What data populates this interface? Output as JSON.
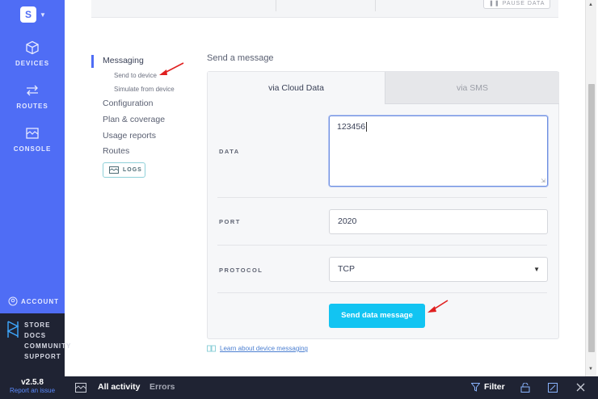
{
  "rail": {
    "logo_letter": "S",
    "items": [
      {
        "label": "DEVICES",
        "icon": "cube-icon"
      },
      {
        "label": "ROUTES",
        "icon": "routes-icon"
      },
      {
        "label": "CONSOLE",
        "icon": "console-icon"
      }
    ],
    "account_label": "ACCOUNT",
    "links": [
      "STORE",
      "DOCS",
      "COMMUNITY",
      "SUPPORT"
    ],
    "version": "v2.5.8",
    "report_issue": "Report an issue"
  },
  "topbar": {
    "pause_label": "PAUSE DATA"
  },
  "nav": {
    "messaging": "Messaging",
    "send_to_device": "Send to device",
    "simulate_from_device": "Simulate from device",
    "configuration": "Configuration",
    "plan_coverage": "Plan & coverage",
    "usage_reports": "Usage reports",
    "routes": "Routes",
    "logs": "LOGS"
  },
  "main": {
    "section_title": "Send a message",
    "tabs": {
      "cloud": "via Cloud Data",
      "sms": "via SMS"
    },
    "data_label": "DATA",
    "data_value": "123456",
    "port_label": "PORT",
    "port_value": "2020",
    "protocol_label": "PROTOCOL",
    "protocol_value": "TCP",
    "send_button": "Send data message",
    "learn_link": "Learn about device messaging"
  },
  "bottombar": {
    "all_activity": "All activity",
    "errors": "Errors",
    "filter": "Filter"
  },
  "colors": {
    "rail_blue": "#4f6df5",
    "dark": "#1f2333",
    "button_cyan": "#12c4f2",
    "arrow_red": "#e02020"
  }
}
